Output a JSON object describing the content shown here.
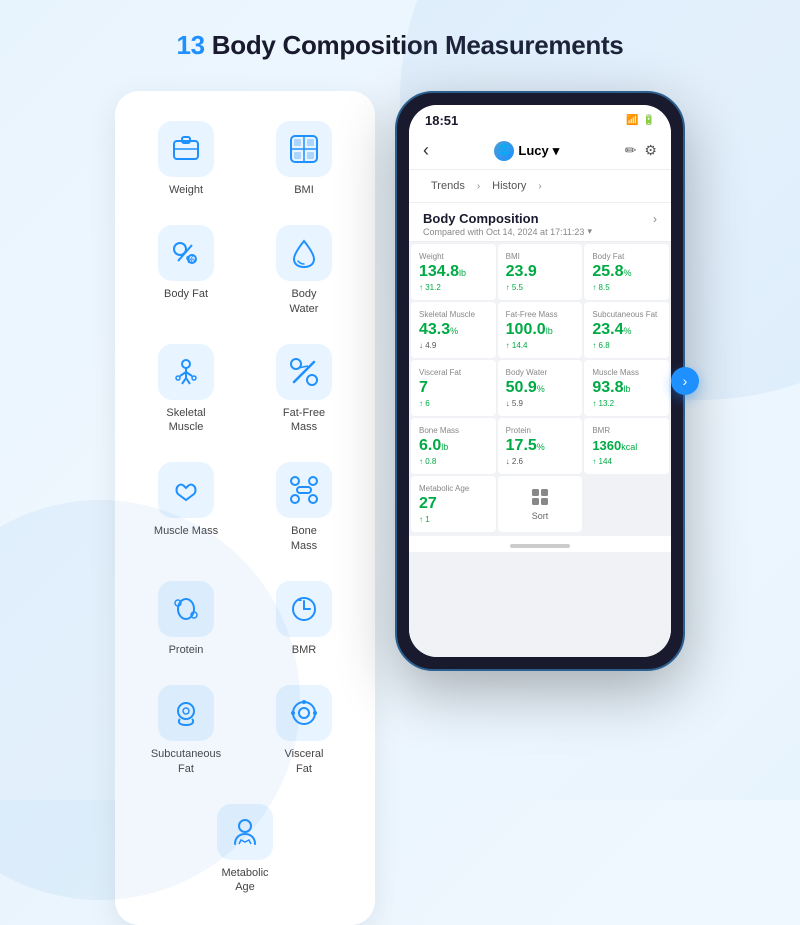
{
  "page": {
    "title_prefix": "13",
    "title_main": " Body Composition Measurements"
  },
  "left_panel": {
    "items": [
      {
        "id": "weight",
        "icon": "⊞",
        "label": "Weight"
      },
      {
        "id": "bmi",
        "icon": "⊟",
        "label": "BMI"
      },
      {
        "id": "body-fat",
        "icon": "%",
        "label": "Body Fat"
      },
      {
        "id": "body-water",
        "icon": "💧",
        "label": "Body\nWater"
      },
      {
        "id": "skeletal-muscle",
        "icon": "🦾",
        "label": "Skeletal\nMuscle"
      },
      {
        "id": "fat-free-mass",
        "icon": "⚡",
        "label": "Fat-Free\nMass"
      },
      {
        "id": "muscle-mass",
        "icon": "💪",
        "label": "Muscle\nMass"
      },
      {
        "id": "bone-mass",
        "icon": "🦴",
        "label": "Bone\nMass"
      },
      {
        "id": "protein",
        "icon": "🔗",
        "label": "Protein"
      },
      {
        "id": "bmr",
        "icon": "🔄",
        "label": "BMR"
      },
      {
        "id": "subcutaneous-fat",
        "icon": "🫁",
        "label": "Subcutaneous\nFat"
      },
      {
        "id": "visceral-fat",
        "icon": "⭕",
        "label": "Visceral\nFat"
      },
      {
        "id": "metabolic-age",
        "icon": "👤",
        "label": "Metabolic\nAge"
      }
    ]
  },
  "phone": {
    "status_time": "18:51",
    "status_signal": "📶",
    "status_battery": "🔋",
    "nav_back": "‹",
    "user_name": "Lucy",
    "user_dropdown": "▾",
    "nav_edit": "✏",
    "nav_settings": "⚙",
    "tab_trends": "Trends",
    "tab_arrow": "›",
    "tab_history": "History",
    "tab_arrow2": "›",
    "section_title": "Body Composition",
    "section_arrow": "›",
    "section_subtitle": "Compared with Oct 14, 2024 at 17:11:23",
    "metrics": [
      {
        "label": "Weight",
        "value": "134.8",
        "unit": "lb",
        "change": "↑ 31.2",
        "up": true
      },
      {
        "label": "BMI",
        "value": "23.9",
        "unit": "",
        "change": "↑ 5.5",
        "up": true
      },
      {
        "label": "Body Fat",
        "value": "25.8",
        "unit": "%",
        "change": "↑ 8.5",
        "up": true
      },
      {
        "label": "Skeletal Muscle",
        "value": "43.3",
        "unit": "%",
        "change": "↓ 4.9",
        "up": false
      },
      {
        "label": "Fat-Free Mass",
        "value": "100.0",
        "unit": "lb",
        "change": "↑ 14.4",
        "up": true
      },
      {
        "label": "Subcutaneous Fat",
        "value": "23.4",
        "unit": "%",
        "change": "↑ 6.8",
        "up": true
      },
      {
        "label": "Visceral Fat",
        "value": "7",
        "unit": "",
        "change": "↑ 6",
        "up": true
      },
      {
        "label": "Body Water",
        "value": "50.9",
        "unit": "%",
        "change": "↓ 5.9",
        "up": false
      },
      {
        "label": "Muscle Mass",
        "value": "93.8",
        "unit": "lb",
        "change": "↑ 13.2",
        "up": true
      },
      {
        "label": "Bone Mass",
        "value": "6.0",
        "unit": "lb",
        "change": "↑ 0.8",
        "up": true
      },
      {
        "label": "Protein",
        "value": "17.5",
        "unit": "%",
        "change": "↓ 2.6",
        "up": false
      },
      {
        "label": "BMR",
        "value": "1360",
        "unit": "kcal",
        "change": "↑ 144",
        "up": true
      },
      {
        "label": "Metabolic Age",
        "value": "27",
        "unit": "",
        "change": "↑ 1",
        "up": true
      }
    ],
    "sort_label": "Sort"
  }
}
